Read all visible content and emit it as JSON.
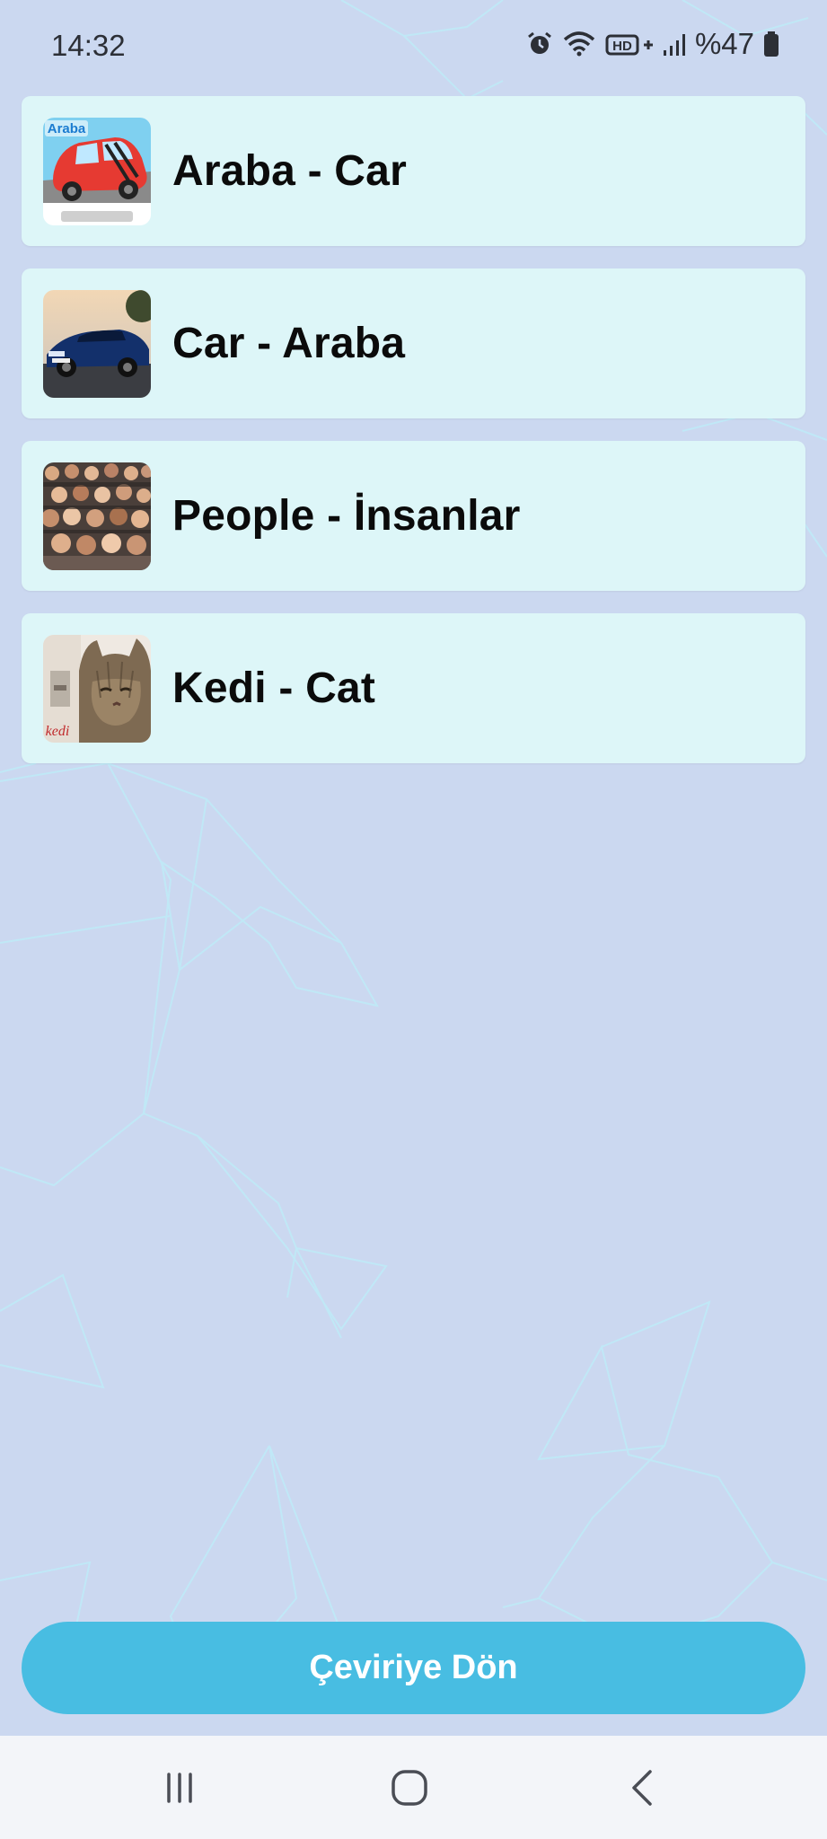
{
  "status_bar": {
    "time": "14:32",
    "battery_text": "%47",
    "icons": [
      "alarm-icon",
      "wifi-icon",
      "hd-plus-icon",
      "signal-icon",
      "battery-icon"
    ]
  },
  "items": [
    {
      "label": "Araba - Car",
      "thumbnail": "cartoon-car-thumbnail",
      "thumb_text": "Araba"
    },
    {
      "label": "Car - Araba",
      "thumbnail": "blue-sports-car-thumbnail"
    },
    {
      "label": "People - İnsanlar",
      "thumbnail": "crowd-thumbnail"
    },
    {
      "label": "Kedi - Cat",
      "thumbnail": "cat-thumbnail",
      "thumb_text": "kedi"
    }
  ],
  "cta": {
    "label": "Çeviriye Dön"
  },
  "colors": {
    "background": "#cbd8f0",
    "card": "#ddf6f8",
    "accent": "#48bde2",
    "text": "#0b0b0b"
  },
  "nav": {
    "icons": [
      "recent-apps-icon",
      "home-icon",
      "back-icon"
    ]
  }
}
